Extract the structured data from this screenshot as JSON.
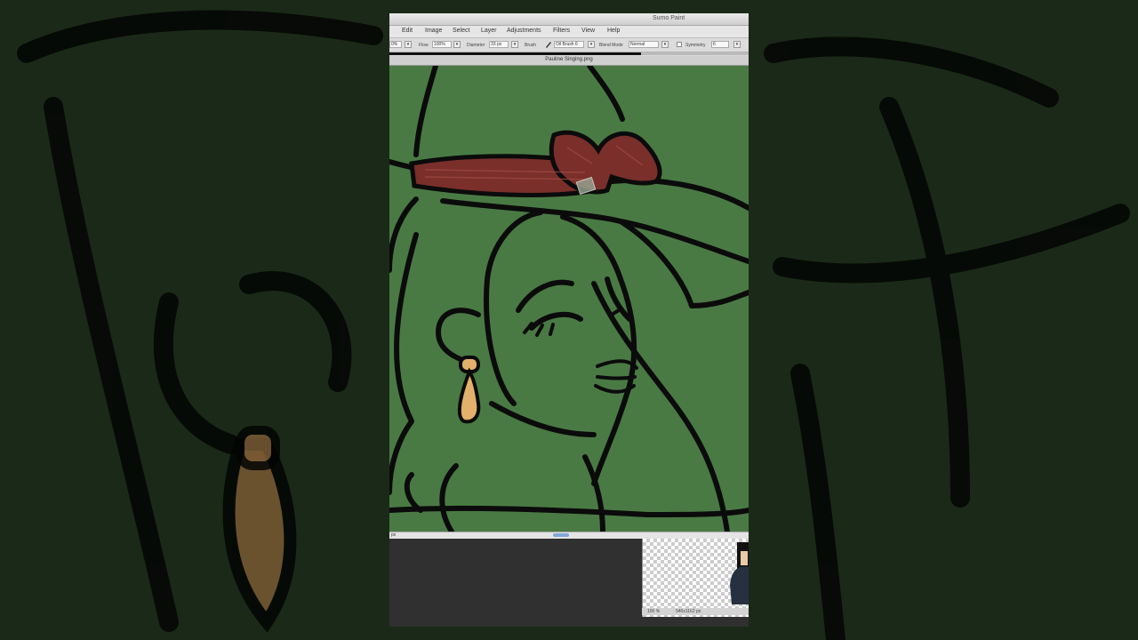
{
  "app": {
    "title": "Sumo Paint"
  },
  "menu": [
    "Edit",
    "Image",
    "Select",
    "Layer",
    "Adjustments",
    "Filters",
    "View",
    "Help"
  ],
  "toolbar": {
    "opacity_value": "0%",
    "flow_label": "Flow",
    "flow_value": "100%",
    "diameter_label": "Diameter",
    "diameter_value": "33 px",
    "brush_label": "Brush",
    "brush_value": "Oil Brush 6",
    "blend_label": "Blend Mode",
    "blend_value": "Normal",
    "symmetry_label": "Symmetry",
    "symmetry_value": "6",
    "dropdown_glyph": "▾"
  },
  "progress": {
    "fraction": 0.7
  },
  "document": {
    "title": "Pauline Singing.png"
  },
  "scrollbar": {
    "left_label": "px"
  },
  "navigator": {
    "zoom": "100 %",
    "size": "540x1162 px"
  },
  "colors": {
    "canvas_green": "#4a7a44",
    "line": "#0b0b0b",
    "ribbon": "#7a2f2b",
    "earring": "#e3b16b"
  }
}
